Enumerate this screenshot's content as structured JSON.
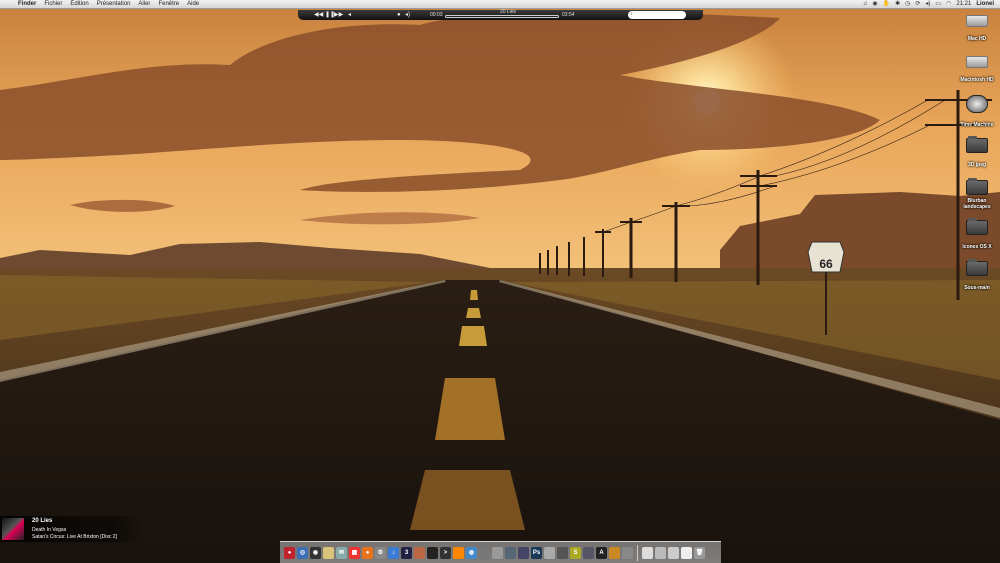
{
  "menubar": {
    "apple": "",
    "app_name": "Finder",
    "menus": [
      "Fichier",
      "Édition",
      "Présentation",
      "Aller",
      "Fenêtre",
      "Aide"
    ],
    "status_icons": [
      "music-note-icon",
      "eye-icon",
      "hand-icon",
      "bluetooth-icon",
      "time-machine-icon",
      "sync-icon",
      "volume-icon",
      "battery-icon",
      "wifi-icon"
    ],
    "clock": "21:21",
    "user": "Lionel"
  },
  "player": {
    "title": "20 Lies",
    "elapsed": "00:03",
    "remaining": "03:54",
    "progress": 0.0,
    "volume": 0.8
  },
  "desktop_icons": [
    {
      "label": "Mac HD",
      "kind": "drive"
    },
    {
      "label": "Macintosh HD",
      "kind": "drive"
    },
    {
      "label": "Time Machine",
      "kind": "timemachine"
    },
    {
      "label": "3D jpeg",
      "kind": "folder"
    },
    {
      "label": "Blurban landscapes",
      "kind": "folder"
    },
    {
      "label": "Icones OS X",
      "kind": "folder"
    },
    {
      "label": "Sous-main",
      "kind": "folder"
    }
  ],
  "now_playing": {
    "title": "20 Lies",
    "artist": "Death In Vegas",
    "album": "Satan's Circus: Live At Brixton [Disc 2]"
  },
  "dock": {
    "apps": [
      {
        "name": "app-record",
        "color": "#c0232b",
        "glyph": "●"
      },
      {
        "name": "app-safari",
        "color": "#3b6fb6",
        "glyph": "◎"
      },
      {
        "name": "app-dashboard",
        "color": "#333",
        "glyph": "◉"
      },
      {
        "name": "app-preview",
        "color": "#d9c27a",
        "glyph": ""
      },
      {
        "name": "app-mail",
        "color": "#8aa",
        "glyph": "✉"
      },
      {
        "name": "app-calendar",
        "color": "#e33",
        "glyph": "▦"
      },
      {
        "name": "app-firefox",
        "color": "#e8731a",
        "glyph": "●"
      },
      {
        "name": "app-system-prefs",
        "color": "#888",
        "glyph": "⚙"
      },
      {
        "name": "app-itunes",
        "color": "#3a7bd5",
        "glyph": "♪"
      },
      {
        "name": "app-3",
        "color": "#224",
        "glyph": "3"
      },
      {
        "name": "app-photos",
        "color": "#b64",
        "glyph": ""
      },
      {
        "name": "app-clapper",
        "color": "#222",
        "glyph": ""
      },
      {
        "name": "app-terminal",
        "color": "#333",
        "glyph": ">"
      },
      {
        "name": "app-vlc",
        "color": "#f80",
        "glyph": ""
      },
      {
        "name": "app-network",
        "color": "#48c",
        "glyph": "◍"
      },
      {
        "name": "app-activity",
        "color": "#777",
        "glyph": ""
      },
      {
        "name": "app-tools",
        "color": "#999",
        "glyph": ""
      },
      {
        "name": "app-utility",
        "color": "#567",
        "glyph": ""
      },
      {
        "name": "app-indesign",
        "color": "#446",
        "glyph": ""
      },
      {
        "name": "app-photoshop",
        "color": "#1b3a5a",
        "glyph": "Ps"
      },
      {
        "name": "app-grey1",
        "color": "#aaa",
        "glyph": ""
      },
      {
        "name": "app-imagecapture",
        "color": "#555",
        "glyph": ""
      },
      {
        "name": "app-skype",
        "color": "#aa2",
        "glyph": "S"
      },
      {
        "name": "app-monitor",
        "color": "#556",
        "glyph": ""
      },
      {
        "name": "app-dictionary",
        "color": "#222",
        "glyph": "A"
      },
      {
        "name": "app-preview2",
        "color": "#c82",
        "glyph": ""
      },
      {
        "name": "app-finder2",
        "color": "#888",
        "glyph": ""
      }
    ],
    "stacks": [
      {
        "name": "stack-documents",
        "color": "#ddd",
        "glyph": ""
      },
      {
        "name": "stack-downloads",
        "color": "#bbb",
        "glyph": ""
      },
      {
        "name": "stack-apps",
        "color": "#ccc",
        "glyph": ""
      },
      {
        "name": "stack-screens",
        "color": "#eee",
        "glyph": ""
      },
      {
        "name": "trash",
        "color": "#999",
        "glyph": "🗑"
      }
    ]
  }
}
